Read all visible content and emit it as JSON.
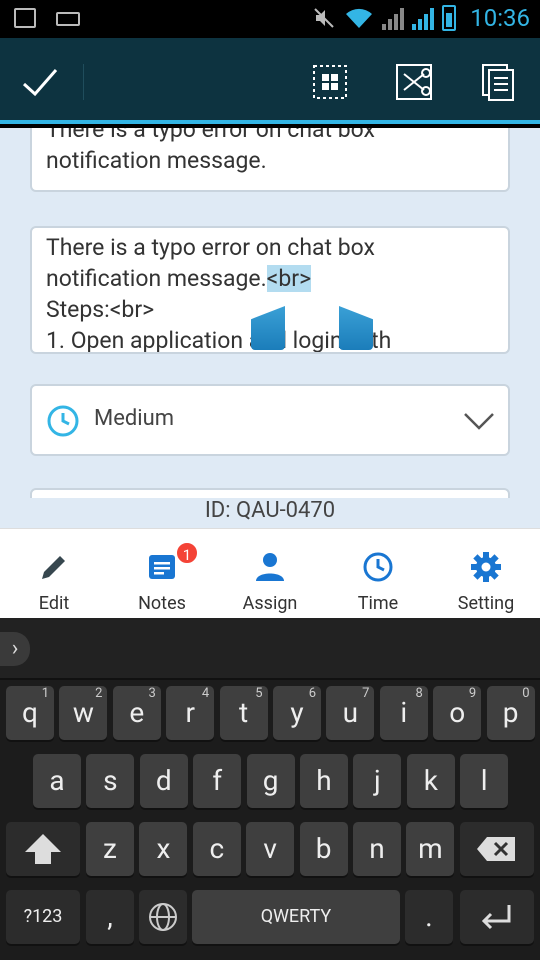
{
  "status": {
    "time": "10:36",
    "network": "R"
  },
  "actionbar": {
    "done_icon": "checkmark-icon",
    "select_all_icon": "select-all-icon",
    "cut_icon": "cut-icon",
    "copy_icon": "copy-icon"
  },
  "fields": {
    "title_text": "There is a typo error on chat box notification message.",
    "desc_line1": "There is a typo error on chat box",
    "desc_line2_pre": "notification message.",
    "desc_selected": "<br>",
    "desc_line3": "Steps:<br>",
    "desc_line4": "1. Open application and login with"
  },
  "priority": {
    "label": "Medium"
  },
  "id_label": "ID: QAU-0470",
  "nav": [
    {
      "label": "Edit"
    },
    {
      "label": "Notes",
      "badge": "1"
    },
    {
      "label": "Assign"
    },
    {
      "label": "Time"
    },
    {
      "label": "Setting"
    }
  ],
  "keyboard": {
    "row1": [
      [
        "q",
        "1"
      ],
      [
        "w",
        "2"
      ],
      [
        "e",
        "3"
      ],
      [
        "r",
        "4"
      ],
      [
        "t",
        "5"
      ],
      [
        "y",
        "6"
      ],
      [
        "u",
        "7"
      ],
      [
        "i",
        "8"
      ],
      [
        "o",
        "9"
      ],
      [
        "p",
        "0"
      ]
    ],
    "row2": [
      "a",
      "s",
      "d",
      "f",
      "g",
      "h",
      "j",
      "k",
      "l"
    ],
    "row3": [
      "z",
      "x",
      "c",
      "v",
      "b",
      "n",
      "m"
    ],
    "symbols": "?123",
    "comma": ",",
    "space": "QWERTY",
    "period": "."
  },
  "colors": {
    "accent": "#33b5e5",
    "actionbar": "#0d3340",
    "nav_blue": "#1976d2",
    "badge": "#f44336"
  }
}
